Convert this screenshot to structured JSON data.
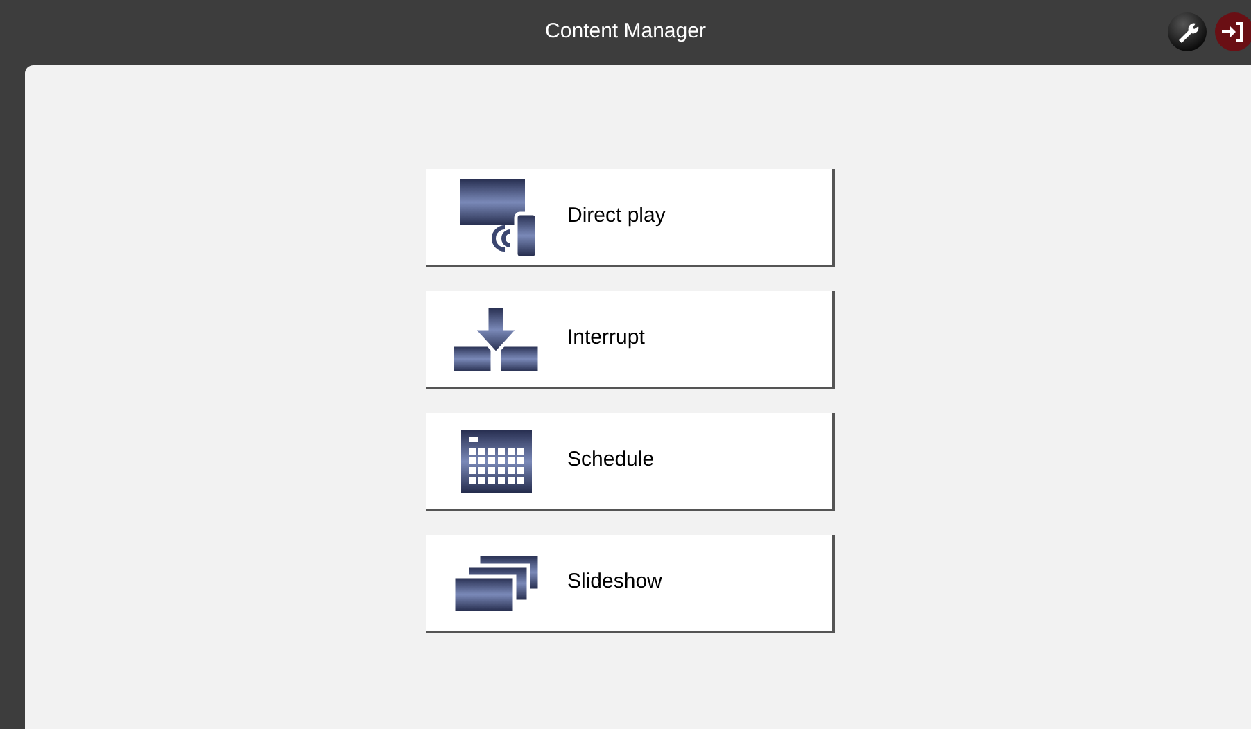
{
  "window": {
    "title": "Content Manager"
  },
  "toolbar": [
    {
      "kind": "settings"
    },
    {
      "kind": "logout"
    }
  ],
  "menu": [
    {
      "label": "Direct play",
      "kind": "direct"
    },
    {
      "label": "Interrupt",
      "kind": "interrupt"
    },
    {
      "label": "Schedule",
      "kind": "schedule"
    },
    {
      "label": "Slideshow",
      "kind": "slideshow"
    }
  ]
}
